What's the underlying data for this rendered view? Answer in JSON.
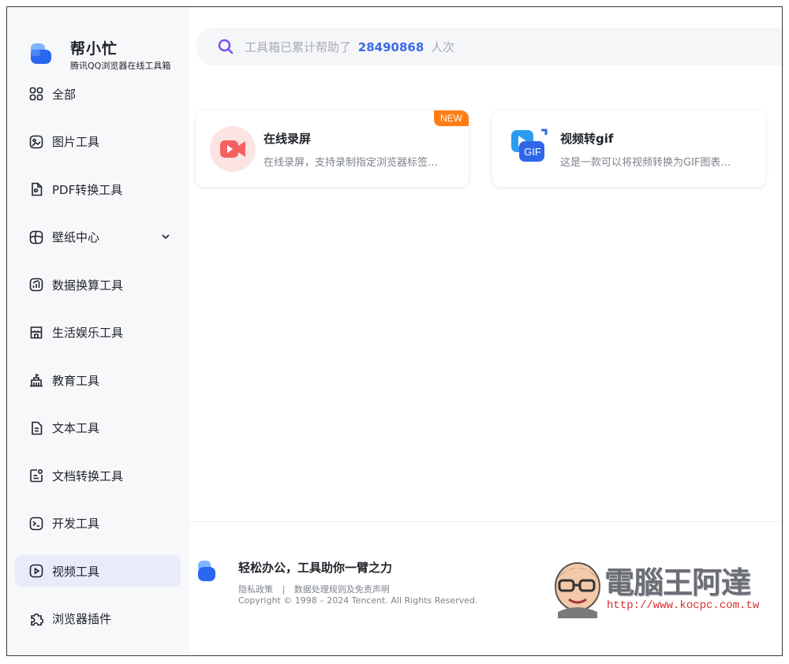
{
  "brand": {
    "name": "帮小忙",
    "subtitle": "腾讯QQ浏览器在线工具箱"
  },
  "sidebar": {
    "items": [
      {
        "label": "全部",
        "icon": "grid-icon"
      },
      {
        "label": "图片工具",
        "icon": "image-icon"
      },
      {
        "label": "PDF转换工具",
        "icon": "pdf-icon"
      },
      {
        "label": "壁纸中心",
        "icon": "wallpaper-icon",
        "expandable": true
      },
      {
        "label": "数据换算工具",
        "icon": "chart-icon"
      },
      {
        "label": "生活娱乐工具",
        "icon": "shop-icon"
      },
      {
        "label": "教育工具",
        "icon": "school-icon"
      },
      {
        "label": "文本工具",
        "icon": "text-doc-icon"
      },
      {
        "label": "文档转换工具",
        "icon": "doc-convert-icon"
      },
      {
        "label": "开发工具",
        "icon": "terminal-icon"
      },
      {
        "label": "视频工具",
        "icon": "video-icon",
        "active": true
      },
      {
        "label": "浏览器插件",
        "icon": "puzzle-icon"
      }
    ]
  },
  "search": {
    "prefix": "工具箱已累计帮助了",
    "count": "28490868",
    "suffix": "人次"
  },
  "cards": [
    {
      "title": "在线录屏",
      "desc": "在线录屏，支持录制指定浏览器标签…",
      "badge": "NEW",
      "icon": "screen-record-icon"
    },
    {
      "title": "视频转gif",
      "desc": "这是一款可以将视频转换为GIF图表…",
      "icon": "video-to-gif-icon",
      "icon_text": "GIF"
    }
  ],
  "footer": {
    "slogan": "轻松办公，工具助你一臂之力",
    "privacy": "隐私政策",
    "separator": "|",
    "data_rules": "数据处理规则及免责声明",
    "copyright": "Copyright © 1998 – 2024 Tencent. All Rights Reserved."
  },
  "watermark": {
    "title": "電腦王阿達",
    "url": "http://www.kocpc.com.tw"
  },
  "colors": {
    "accent": "#3d6be6",
    "badge": "#ff7d14",
    "active_bg": "#e9ebfb",
    "search_icon": "#7b4cf0"
  }
}
